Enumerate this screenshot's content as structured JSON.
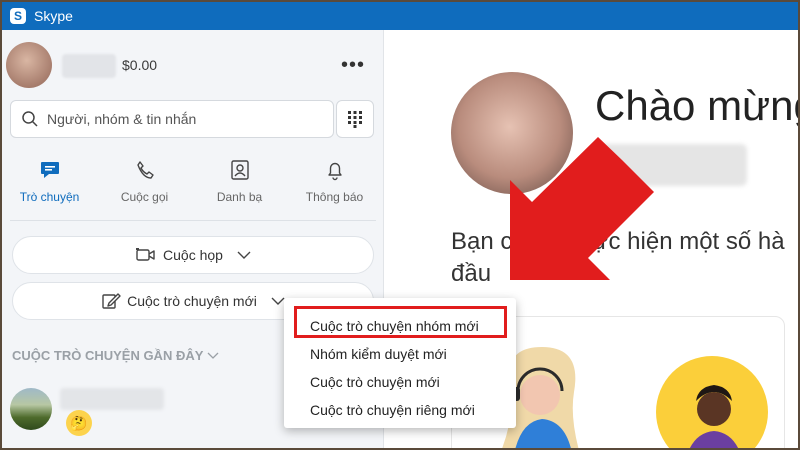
{
  "window": {
    "app_name": "Skype",
    "logo_letter": "S"
  },
  "profile": {
    "balance": "$0.00",
    "more_label": "•••"
  },
  "search": {
    "placeholder": "Người, nhóm & tin nhắn"
  },
  "nav": {
    "tabs": [
      {
        "label": "Trò chuyện",
        "icon": "chat-icon",
        "active": true
      },
      {
        "label": "Cuộc gọi",
        "icon": "phone-icon",
        "active": false
      },
      {
        "label": "Danh bạ",
        "icon": "contacts-icon",
        "active": false
      },
      {
        "label": "Thông báo",
        "icon": "bell-icon",
        "active": false
      }
    ]
  },
  "actions": {
    "meeting_label": "Cuộc họp",
    "new_chat_label": "Cuộc trò chuyện mới"
  },
  "recent": {
    "heading": "CUỘC TRÒ CHUYỆN GẦN ĐÂY",
    "emoji": "🤔"
  },
  "main": {
    "welcome_title": "Chào mừng",
    "intro_line1": "Bạn có thể thực hiện một số hà",
    "intro_line2": "đầu"
  },
  "dropdown": {
    "items": [
      {
        "label": "Cuộc trò chuyện nhóm mới"
      },
      {
        "label": "Nhóm kiểm duyệt mới"
      },
      {
        "label": "Cuộc trò chuyện mới"
      },
      {
        "label": "Cuộc trò chuyện riêng mới"
      }
    ]
  },
  "colors": {
    "skype_blue": "#0f6cbd",
    "annotation_red": "#e11d1d"
  }
}
